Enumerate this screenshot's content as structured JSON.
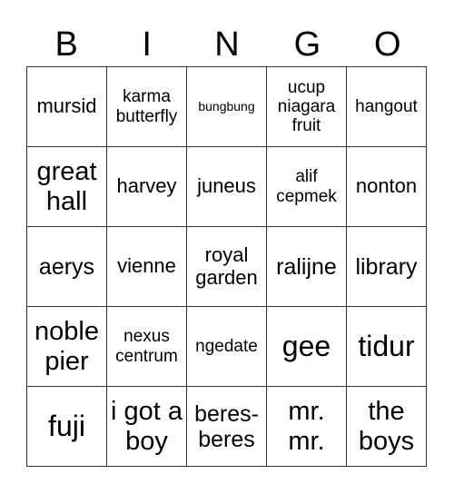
{
  "title_letters": [
    "B",
    "I",
    "N",
    "G",
    "O"
  ],
  "cells": [
    [
      {
        "text": "mursid",
        "size": "m"
      },
      {
        "text": "karma butterfly",
        "size": "s"
      },
      {
        "text": "bungbung",
        "size": "xs"
      },
      {
        "text": "ucup niagara fruit",
        "size": "s"
      },
      {
        "text": "hangout",
        "size": "s"
      }
    ],
    [
      {
        "text": "great hall",
        "size": "xl"
      },
      {
        "text": "harvey",
        "size": "m"
      },
      {
        "text": "juneus",
        "size": "m"
      },
      {
        "text": "alif cepmek",
        "size": "s"
      },
      {
        "text": "nonton",
        "size": "m"
      }
    ],
    [
      {
        "text": "aerys",
        "size": "l"
      },
      {
        "text": "vienne",
        "size": "m"
      },
      {
        "text": "royal garden",
        "size": "m"
      },
      {
        "text": "ralijne",
        "size": "l"
      },
      {
        "text": "library",
        "size": "l"
      }
    ],
    [
      {
        "text": "noble pier",
        "size": "xl"
      },
      {
        "text": "nexus centrum",
        "size": "s"
      },
      {
        "text": "ngedate",
        "size": "s"
      },
      {
        "text": "gee",
        "size": "xxl"
      },
      {
        "text": "tidur",
        "size": "xxl"
      }
    ],
    [
      {
        "text": "fuji",
        "size": "xxl"
      },
      {
        "text": "i got a boy",
        "size": "xl"
      },
      {
        "text": "beres-beres",
        "size": "l"
      },
      {
        "text": "mr. mr.",
        "size": "xl"
      },
      {
        "text": "the boys",
        "size": "xl"
      }
    ]
  ]
}
